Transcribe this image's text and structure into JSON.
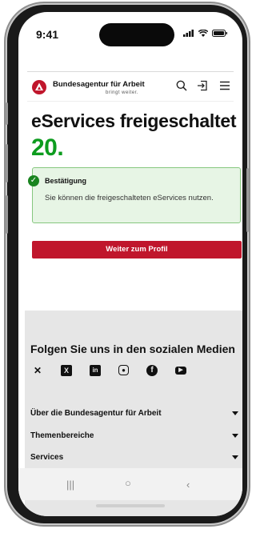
{
  "status_bar": {
    "time": "9:41"
  },
  "header": {
    "brand": "Bundesagentur für Arbeit",
    "tagline": "bringt weiter."
  },
  "page": {
    "title": "eServices freigeschaltet",
    "badge": "20."
  },
  "confirmation": {
    "title": "Bestätigung",
    "text": "Sie können die freigeschalteten eServices nutzen."
  },
  "primary_button": {
    "label": "Weiter zum Profil"
  },
  "footer": {
    "social_title": "Folgen Sie uns in den sozialen Medien",
    "social_icons": [
      "x-icon",
      "xing-icon",
      "linkedin-icon",
      "instagram-icon",
      "facebook-icon",
      "youtube-icon"
    ],
    "accordion": [
      {
        "label": "Über die Bundesagentur für Arbeit"
      },
      {
        "label": "Themenbereiche"
      },
      {
        "label": "Services"
      }
    ]
  },
  "colors": {
    "brand_red": "#c0162c",
    "success_green": "#0d9c1f",
    "success_bg": "#e7f5e5",
    "footer_bg": "#e6e6e6"
  }
}
